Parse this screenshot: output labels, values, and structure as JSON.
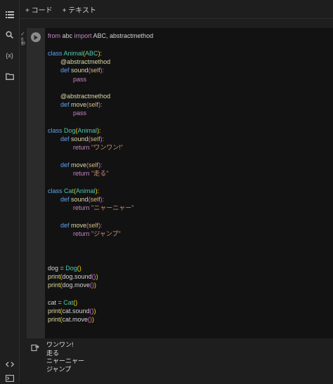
{
  "toolbar": {
    "add_code_label": "+ コード",
    "add_text_label": "+ テキスト"
  },
  "sidebar": {
    "icons": [
      "menu-icon",
      "search-icon",
      "variables-icon",
      "folder-icon",
      "code-snippets-icon",
      "terminal-icon"
    ],
    "variables_symbol": "{x}"
  },
  "cell": {
    "status_check": "✓",
    "status_time": "0\n秒",
    "code": {
      "l1": [
        "from",
        " abc ",
        "import",
        " ABC, abstractmethod"
      ],
      "l3": [
        "class",
        " ",
        "Animal",
        "(",
        "ABC",
        "):"
      ],
      "l4": [
        "@abstractmethod"
      ],
      "l5": [
        "def",
        " ",
        "sound",
        "(",
        "self",
        "):"
      ],
      "l6": [
        "pass"
      ],
      "l8": [
        "@abstractmethod"
      ],
      "l9": [
        "def",
        " ",
        "move",
        "(",
        "self",
        "):"
      ],
      "l10": [
        "pass"
      ],
      "l12": [
        "class",
        " ",
        "Dog",
        "(",
        "Animal",
        "):"
      ],
      "l13": [
        "def",
        " ",
        "sound",
        "(",
        "self",
        "):"
      ],
      "l14": [
        "return",
        " ",
        "\"ワンワン!\""
      ],
      "l16": [
        "def",
        " ",
        "move",
        "(",
        "self",
        "):"
      ],
      "l17": [
        "return",
        " ",
        "\"走る\""
      ],
      "l19": [
        "class",
        " ",
        "Cat",
        "(",
        "Animal",
        "):"
      ],
      "l20": [
        "def",
        " ",
        "sound",
        "(",
        "self",
        "):"
      ],
      "l21": [
        "return",
        " ",
        "\"ニャーニャー\""
      ],
      "l23": [
        "def",
        " ",
        "move",
        "(",
        "self",
        "):"
      ],
      "l24": [
        "return",
        " ",
        "\"ジャンプ\""
      ],
      "l28": [
        "dog = ",
        "Dog",
        "()"
      ],
      "l29": [
        "print",
        "(",
        "dog.sound",
        "()",
        ")"
      ],
      "l30": [
        "print",
        "(",
        "dog.move",
        "()",
        ")"
      ],
      "l32": [
        "cat = ",
        "Cat",
        "()"
      ],
      "l33": [
        "print",
        "(",
        "cat.sound",
        "()",
        ")"
      ],
      "l34": [
        "print",
        "(",
        "cat.move",
        "()",
        ")"
      ]
    }
  },
  "output": {
    "lines": [
      "ワンワン!",
      "走る",
      "ニャーニャー",
      "ジャンプ"
    ]
  }
}
